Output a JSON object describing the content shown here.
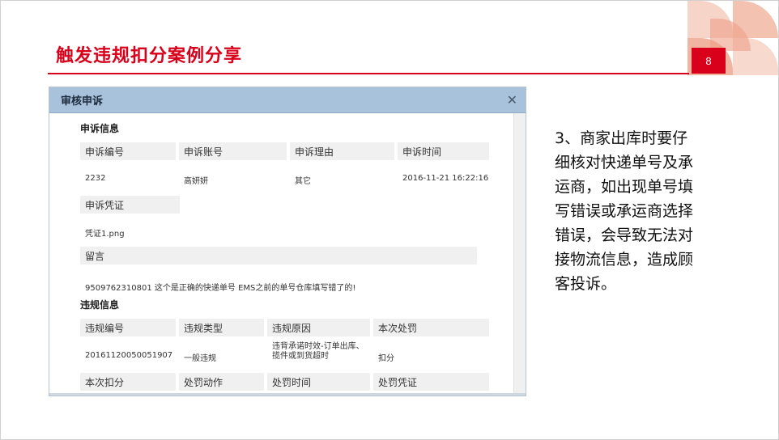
{
  "slide": {
    "title": "触发违规扣分案例分享",
    "page_number": "8",
    "note": "3、商家出库时要仔细核对快递单号及承运商，如出现单号填写错误或承运商选择错误，会导致无法对接物流信息，造成顾客投诉。"
  },
  "dialog": {
    "title": "审核申诉",
    "close_glyph": "✕",
    "appeal_section": "申诉信息",
    "appeal_headers": [
      "申诉编号",
      "申诉账号",
      "申诉理由",
      "申诉时间"
    ],
    "appeal_values": [
      "2232",
      "高妍妍",
      "其它",
      "2016-11-21 16:22:16"
    ],
    "proof_header": "申诉凭证",
    "proof_value": "凭证1.png",
    "message_header": "留言",
    "message_value": "9509762310801 这个是正确的快递单号 EMS之前的单号仓库填写错了的!",
    "violation_section": "违规信息",
    "violation_headers": [
      "违规编号",
      "违规类型",
      "违规原因",
      "本次处罚"
    ],
    "violation_values": [
      "20161120050051907",
      "一般违规",
      "违背承诺时效-订单出库、揽件或到货超时",
      "扣分"
    ],
    "violation_headers2": [
      "本次扣分",
      "处罚动作",
      "处罚时间",
      "处罚凭证"
    ]
  }
}
